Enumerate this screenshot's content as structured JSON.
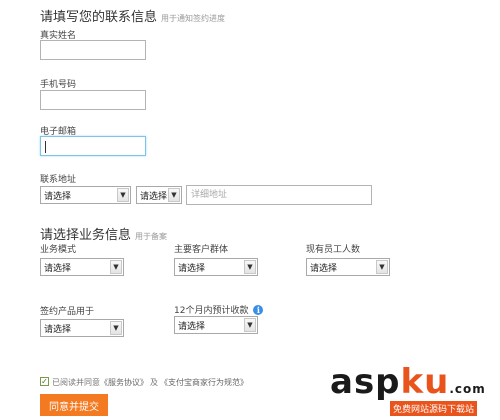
{
  "contact": {
    "title": "请填写您的联系信息",
    "hint": "用于通知签约进度",
    "name_label": "真实姓名",
    "name_value": "",
    "phone_label": "手机号码",
    "phone_value": "",
    "email_label": "电子邮箱",
    "email_value": "",
    "address_label": "联系地址",
    "province_select": "请选择",
    "city_select": "请选择",
    "address_placeholder": "详细地址"
  },
  "business": {
    "title": "请选择业务信息",
    "hint": "用于备案",
    "mode_label": "业务模式",
    "mode_select": "请选择",
    "customer_label": "主要客户群体",
    "customer_select": "请选择",
    "staff_label": "现有员工人数",
    "staff_select": "请选择",
    "product_label": "签约产品用于",
    "product_select": "请选择",
    "income_label": "12个月内预计收款",
    "income_select": "请选择"
  },
  "agreement": {
    "checked": true,
    "prefix": "已阅读并同意",
    "link1": "《服务协议》",
    "joiner": "及",
    "link2": "《支付宝商家行为规范》"
  },
  "submit_label": "同意并提交",
  "watermark": {
    "text_a": "asp",
    "text_b": "ku",
    "suffix": ".com",
    "subtitle": "免费网站源码下载站"
  },
  "colors": {
    "submit_bg": "#f37a21",
    "focus_border": "#7fc3e8",
    "info_icon": "#3a8ee6"
  }
}
